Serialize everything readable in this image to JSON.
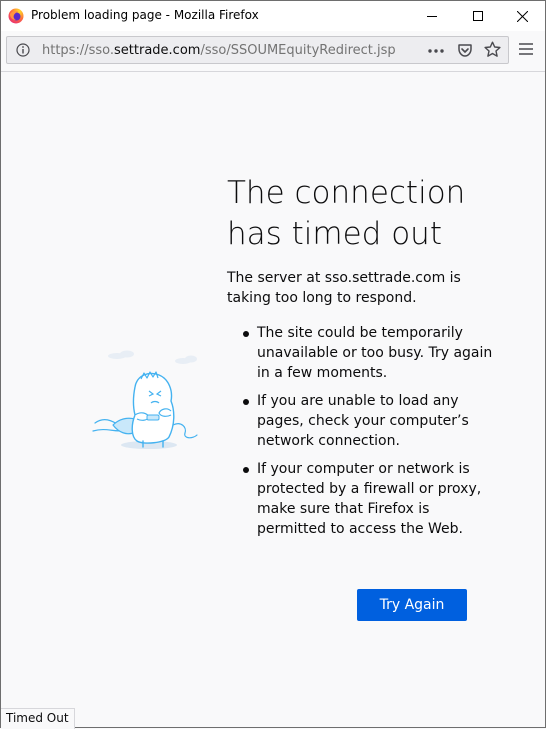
{
  "window": {
    "title": "Problem loading page - Mozilla Firefox"
  },
  "toolbar": {
    "url_prefix": "https://sso.",
    "url_host": "settrade.com",
    "url_suffix": "/sso/SSOUMEquityRedirect.jsp"
  },
  "error": {
    "title": "The connection has timed out",
    "description": "The server at sso.settrade.com is taking too long to respond.",
    "tips": [
      "The site could be temporarily unavailable or too busy. Try again in a few moments.",
      "If you are unable to load any pages, check your computer’s network connection.",
      "If your computer or network is protected by a firewall or proxy, make sure that Firefox is permitted to access the Web."
    ],
    "try_again_label": "Try Again"
  },
  "statusbar": {
    "text": "Timed Out"
  },
  "colors": {
    "accent": "#0060df",
    "illustration": "#44b2f0"
  }
}
